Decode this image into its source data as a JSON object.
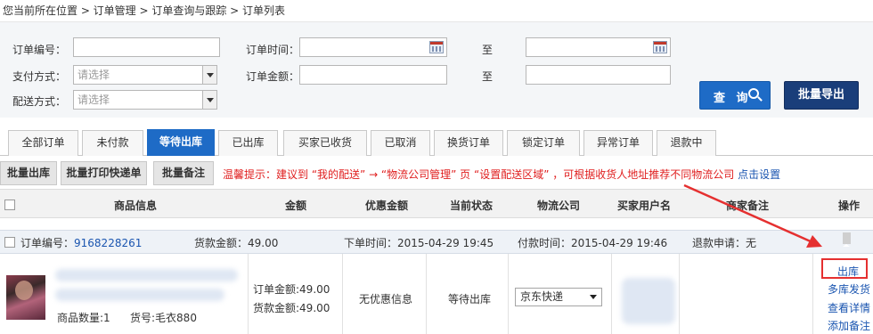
{
  "breadcrumb": "您当前所在位置 > 订单管理 > 订单查询与跟踪 > 订单列表",
  "filters": {
    "order_no_label": "订单编号：",
    "order_time_label": "订单时间：",
    "to_label": "至",
    "payment_label": "支付方式：",
    "payment_placeholder": "请选择",
    "amount_label": "订单金额：",
    "delivery_label": "配送方式：",
    "delivery_placeholder": "请选择"
  },
  "buttons": {
    "search": "查 询",
    "batch_export": "批量导出"
  },
  "tabs": [
    "全部订单",
    "未付款",
    "等待出库",
    "已出库",
    "买家已收货",
    "已取消",
    "换货订单",
    "锁定订单",
    "异常订单",
    "退款中"
  ],
  "active_tab": "等待出库",
  "actions": {
    "batch_ship": "批量出库",
    "batch_print": "批量打印快递单",
    "batch_note": "批量备注"
  },
  "tip": {
    "text": "温馨提示：建议到 “我的配送” → “物流公司管理” 页 “设置配送区域” ，可根据收货人地址推荐不同物流公司",
    "link": "点击设置"
  },
  "columns": [
    "商品信息",
    "金额",
    "优惠金额",
    "当前状态",
    "物流公司",
    "买家用户名",
    "商家备注",
    "操作"
  ],
  "order": {
    "order_no_label": "订单编号：",
    "order_no": "9168228261",
    "goods_amount": "货款金额：49.00",
    "order_time": "下单时间：2015-04-29 19:45",
    "pay_time": "付款时间：2015-04-29 19:46",
    "refund": "退款申请：无",
    "quantity": "商品数量:1",
    "sku": "货号:毛衣880",
    "order_amount": "订单金额:49.00",
    "goods_amount2": "货款金额:49.00",
    "discount": "无优惠信息",
    "status": "等待出库",
    "logistics": "京东快递",
    "ops": [
      "出库",
      "多库发货",
      "查看详情",
      "添加备注"
    ]
  },
  "colors": {
    "accent": "#1e6bc6",
    "export_btn": "#1a3e7a",
    "warning": "#e02020",
    "link": "#1a55b0"
  }
}
